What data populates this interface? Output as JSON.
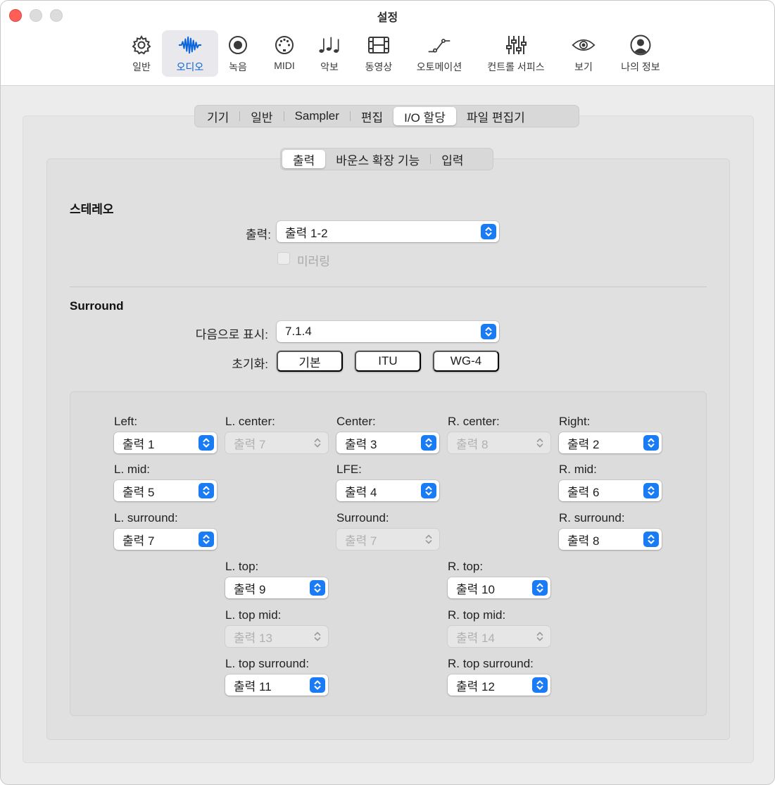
{
  "window": {
    "title": "설정"
  },
  "toolbar": {
    "items": [
      {
        "label": "일반",
        "icon": "gear-icon"
      },
      {
        "label": "오디오",
        "icon": "waveform-icon"
      },
      {
        "label": "녹음",
        "icon": "record-icon"
      },
      {
        "label": "MIDI",
        "icon": "midi-port-icon"
      },
      {
        "label": "악보",
        "icon": "music-notes-icon"
      },
      {
        "label": "동영상",
        "icon": "film-icon"
      },
      {
        "label": "오토메이션",
        "icon": "automation-curve-icon"
      },
      {
        "label": "컨트롤 서피스",
        "icon": "faders-icon"
      },
      {
        "label": "보기",
        "icon": "eye-icon"
      },
      {
        "label": "나의 정보",
        "icon": "person-icon"
      }
    ],
    "active_index": 1
  },
  "colors": {
    "accent": "#1a7cf5",
    "active_label": "#0a63d8",
    "close": "#ff5f57"
  },
  "tabs": [
    "기기",
    "일반",
    "Sampler",
    "편집",
    "I/O 할당",
    "파일 편집기"
  ],
  "subtabs": [
    "출력",
    "바운스 확장 기능",
    "입력"
  ],
  "stereo": {
    "title": "스테레오",
    "output_label": "출력:",
    "output_value": "출력 1-2",
    "mirroring_label": "미러링"
  },
  "surround": {
    "title": "Surround",
    "display_label": "다음으로 표시:",
    "display_value": "7.1.4",
    "reset_label": "초기화:",
    "reset_buttons": [
      "기본",
      "ITU",
      "WG-4"
    ]
  },
  "channels": {
    "left": {
      "label": "Left:",
      "value": "출력 1"
    },
    "l_center": {
      "label": "L. center:",
      "value": "출력 7"
    },
    "center": {
      "label": "Center:",
      "value": "출력 3"
    },
    "r_center": {
      "label": "R. center:",
      "value": "출력 8"
    },
    "right": {
      "label": "Right:",
      "value": "출력 2"
    },
    "l_mid": {
      "label": "L. mid:",
      "value": "출력 5"
    },
    "lfe": {
      "label": "LFE:",
      "value": "출력 4"
    },
    "r_mid": {
      "label": "R. mid:",
      "value": "출력 6"
    },
    "l_surround": {
      "label": "L. surround:",
      "value": "출력 7"
    },
    "surround": {
      "label": "Surround:",
      "value": "출력 7"
    },
    "r_surround": {
      "label": "R. surround:",
      "value": "출력 8"
    },
    "l_top": {
      "label": "L. top:",
      "value": "출력 9"
    },
    "r_top": {
      "label": "R. top:",
      "value": "출력 10"
    },
    "l_top_mid": {
      "label": "L. top mid:",
      "value": "출력 13"
    },
    "r_top_mid": {
      "label": "R. top mid:",
      "value": "출력 14"
    },
    "l_top_surround": {
      "label": "L. top surround:",
      "value": "출력 11"
    },
    "r_top_surround": {
      "label": "R. top surround:",
      "value": "출력 12"
    }
  }
}
